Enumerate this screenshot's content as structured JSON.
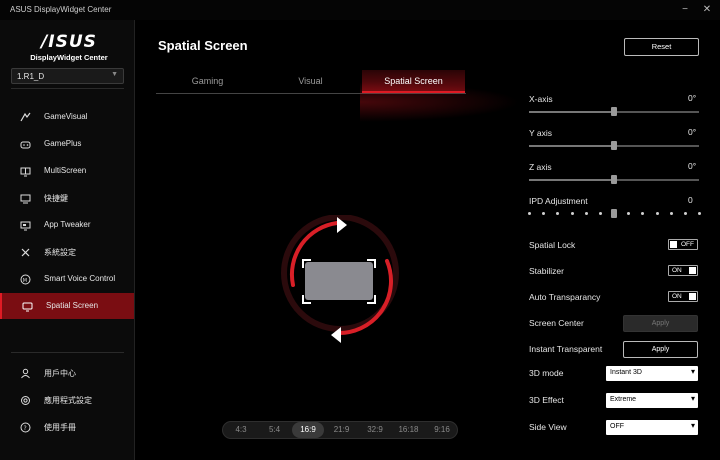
{
  "window": {
    "title": "ASUS DisplayWidget Center",
    "minimize": "−",
    "close": "✕"
  },
  "logo": {
    "brand": "/ISUS",
    "subtitle": "DisplayWidget Center"
  },
  "device": {
    "selected": "1.R1_D"
  },
  "nav": {
    "items": [
      {
        "label": "GameVisual",
        "icon": "gamevisual-icon"
      },
      {
        "label": "GamePlus",
        "icon": "gamepad-icon"
      },
      {
        "label": "MultiScreen",
        "icon": "multiscreen-icon"
      },
      {
        "label": "快捷鍵",
        "icon": "keyboard-icon"
      },
      {
        "label": "App Tweaker",
        "icon": "monitor-app-icon"
      },
      {
        "label": "系統設定",
        "icon": "tools-icon"
      },
      {
        "label": "Smart Voice Control",
        "icon": "voice-icon"
      },
      {
        "label": "Spatial Screen",
        "icon": "spatial-screen-icon"
      }
    ],
    "footer": [
      {
        "label": "用戶中心",
        "icon": "user-icon"
      },
      {
        "label": "應用程式設定",
        "icon": "gear-icon"
      },
      {
        "label": "使用手冊",
        "icon": "help-icon"
      }
    ],
    "active_index": 7
  },
  "main": {
    "title": "Spatial Screen",
    "reset_label": "Reset",
    "tabs": [
      "Gaming",
      "Visual",
      "Spatial Screen"
    ],
    "active_tab": 2
  },
  "sliders": [
    {
      "label": "X-axis",
      "value": "0°",
      "position": 0.5
    },
    {
      "label": "Y axis",
      "value": "0°",
      "position": 0.5
    },
    {
      "label": "Z axis",
      "value": "0°",
      "position": 0.5
    },
    {
      "label": "IPD Adjustment",
      "value": "0",
      "position": 0.5
    }
  ],
  "toggles": [
    {
      "label": "Spatial Lock",
      "state": "OFF",
      "on": false
    },
    {
      "label": "Stabilizer",
      "state": "ON",
      "on": true
    },
    {
      "label": "Auto Transparancy",
      "state": "ON",
      "on": true
    }
  ],
  "actions": [
    {
      "label": "Screen Center",
      "button": "Apply",
      "enabled": false
    },
    {
      "label": "Instant Transparent",
      "button": "Apply",
      "enabled": true
    }
  ],
  "dropdowns": [
    {
      "label": "3D mode",
      "value": "Instant 3D"
    },
    {
      "label": "3D Effect",
      "value": "Extreme"
    },
    {
      "label": "Side View",
      "value": "OFF"
    }
  ],
  "aspect_ratios": {
    "options": [
      "4:3",
      "5:4",
      "16:9",
      "21:9",
      "32:9",
      "16:18",
      "9:16"
    ],
    "selected_index": 2
  },
  "colors": {
    "accent": "#e01b24",
    "active_nav": "#7a0d12"
  }
}
